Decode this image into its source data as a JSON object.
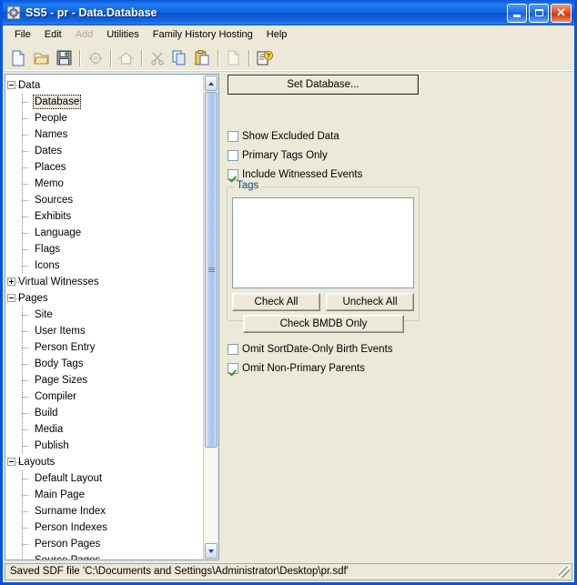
{
  "window": {
    "title": "SS5 - pr - Data.Database",
    "app_icon": "gear-document-icon",
    "controls": {
      "minimize": "Minimize",
      "maximize": "Maximize",
      "close": "Close"
    },
    "accent_title_color": "#0a56d6",
    "face_color": "#ece9d8"
  },
  "menubar": {
    "items": [
      {
        "label": "File",
        "disabled": false
      },
      {
        "label": "Edit",
        "disabled": false
      },
      {
        "label": "Add",
        "disabled": true
      },
      {
        "label": "Utilities",
        "disabled": false
      },
      {
        "label": "Family History Hosting",
        "disabled": false
      },
      {
        "label": "Help",
        "disabled": false
      }
    ]
  },
  "toolbar": {
    "buttons": [
      {
        "icon": "new-document-icon",
        "disabled": false
      },
      {
        "icon": "open-folder-icon",
        "disabled": false
      },
      {
        "icon": "save-floppy-icon",
        "disabled": false
      },
      {
        "sep": true
      },
      {
        "icon": "gear-settings-icon",
        "disabled": true
      },
      {
        "sep": true
      },
      {
        "icon": "home-icon",
        "disabled": true
      },
      {
        "sep": true
      },
      {
        "icon": "cut-scissors-icon",
        "disabled": true
      },
      {
        "icon": "copy-icon",
        "disabled": false
      },
      {
        "icon": "paste-icon",
        "disabled": false
      },
      {
        "sep": true
      },
      {
        "icon": "blank-page-icon",
        "disabled": true
      },
      {
        "sep": true
      },
      {
        "icon": "help-document-icon",
        "disabled": false
      }
    ]
  },
  "tree": {
    "selected": "Database",
    "nodes": [
      {
        "label": "Data",
        "level": 0,
        "expander": "minus"
      },
      {
        "label": "Database",
        "level": 1,
        "expander": "none",
        "selected": true
      },
      {
        "label": "People",
        "level": 1,
        "expander": "none"
      },
      {
        "label": "Names",
        "level": 1,
        "expander": "none"
      },
      {
        "label": "Dates",
        "level": 1,
        "expander": "none"
      },
      {
        "label": "Places",
        "level": 1,
        "expander": "none"
      },
      {
        "label": "Memo",
        "level": 1,
        "expander": "none"
      },
      {
        "label": "Sources",
        "level": 1,
        "expander": "none"
      },
      {
        "label": "Exhibits",
        "level": 1,
        "expander": "none"
      },
      {
        "label": "Language",
        "level": 1,
        "expander": "none"
      },
      {
        "label": "Flags",
        "level": 1,
        "expander": "none"
      },
      {
        "label": "Icons",
        "level": 1,
        "expander": "none"
      },
      {
        "label": "Virtual Witnesses",
        "level": 0,
        "expander": "plus"
      },
      {
        "label": "Pages",
        "level": 0,
        "expander": "minus"
      },
      {
        "label": "Site",
        "level": 1,
        "expander": "none"
      },
      {
        "label": "User Items",
        "level": 1,
        "expander": "none"
      },
      {
        "label": "Person Entry",
        "level": 1,
        "expander": "none"
      },
      {
        "label": "Body Tags",
        "level": 1,
        "expander": "none"
      },
      {
        "label": "Page Sizes",
        "level": 1,
        "expander": "none"
      },
      {
        "label": "Compiler",
        "level": 1,
        "expander": "none"
      },
      {
        "label": "Build",
        "level": 1,
        "expander": "none"
      },
      {
        "label": "Media",
        "level": 1,
        "expander": "none"
      },
      {
        "label": "Publish",
        "level": 1,
        "expander": "none"
      },
      {
        "label": "Layouts",
        "level": 0,
        "expander": "minus"
      },
      {
        "label": "Default Layout",
        "level": 1,
        "expander": "none"
      },
      {
        "label": "Main Page",
        "level": 1,
        "expander": "none"
      },
      {
        "label": "Surname Index",
        "level": 1,
        "expander": "none"
      },
      {
        "label": "Person Indexes",
        "level": 1,
        "expander": "none"
      },
      {
        "label": "Person Pages",
        "level": 1,
        "expander": "none"
      },
      {
        "label": "Source Pages",
        "level": 1,
        "expander": "none"
      }
    ],
    "scrollbar": {
      "up_arrow": "scroll-up-icon",
      "down_arrow": "scroll-down-icon",
      "thumb_fraction": "79%"
    }
  },
  "panel": {
    "set_database_button": "Set Database...",
    "checkboxes": [
      {
        "label": "Show Excluded Data",
        "checked": false
      },
      {
        "label": "Primary Tags Only",
        "checked": false
      },
      {
        "label": "Include Witnessed Events",
        "checked": true
      }
    ],
    "tags_group": {
      "title": "Tags",
      "list_items": [],
      "buttons": {
        "check_all": "Check All",
        "uncheck_all": "Uncheck All",
        "check_bmdb_only": "Check BMDB Only"
      }
    },
    "bottom_checkboxes": [
      {
        "label": "Omit SortDate-Only Birth Events",
        "checked": false
      },
      {
        "label": "Omit Non-Primary Parents",
        "checked": true
      }
    ]
  },
  "statusbar": {
    "message": "Saved SDF file 'C:\\Documents and Settings\\Administrator\\Desktop\\pr.sdf'",
    "grip": "resize-grip-icon"
  }
}
